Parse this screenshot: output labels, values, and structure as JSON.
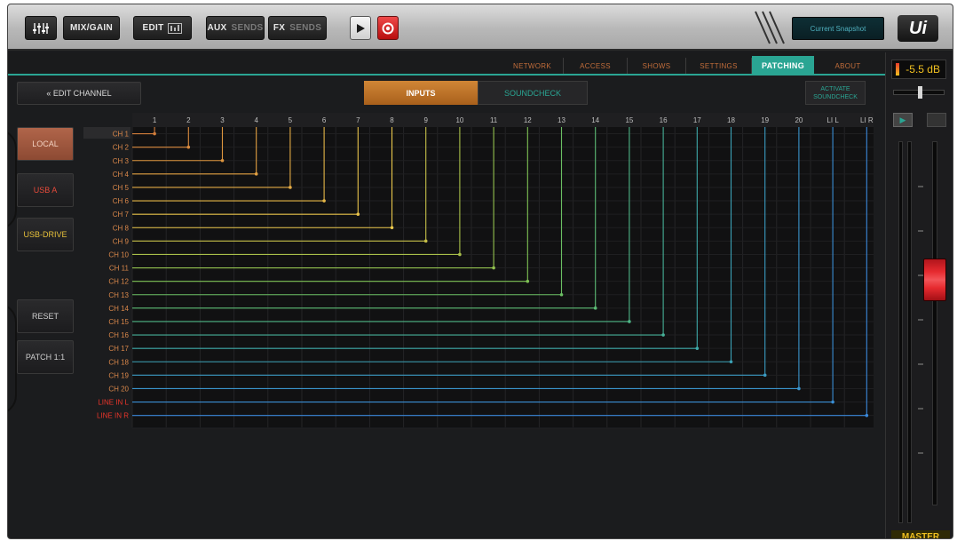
{
  "toolbar": {
    "mixgain_label": "MIX/GAIN",
    "edit_label": "EDIT",
    "aux_label": "AUX",
    "aux_sub": "SENDS",
    "fx_label": "FX",
    "fx_sub": "SENDS",
    "display_text": "Current Snapshot",
    "logo": "Ui"
  },
  "nav": {
    "tabs": [
      "NETWORK",
      "ACCESS",
      "SHOWS",
      "SETTINGS",
      "PATCHING",
      "ABOUT"
    ],
    "active": "PATCHING"
  },
  "body": {
    "edit_channel": "« EDIT CHANNEL",
    "inputs_label": "INPUTS",
    "soundcheck_label": "SOUNDCHECK",
    "activate_label": "ACTIVATE SOUNDCHECK",
    "sources": [
      "LOCAL",
      "USB A",
      "USB-DRIVE"
    ],
    "reset_label": "RESET",
    "patch_label": "PATCH 1:1"
  },
  "matrix": {
    "columns": [
      "1",
      "2",
      "3",
      "4",
      "5",
      "6",
      "7",
      "8",
      "9",
      "10",
      "11",
      "12",
      "13",
      "14",
      "15",
      "16",
      "17",
      "18",
      "19",
      "20",
      "LI L",
      "LI R"
    ],
    "rows": [
      "CH 1",
      "CH 2",
      "CH 3",
      "CH 4",
      "CH 5",
      "CH 6",
      "CH 7",
      "CH 8",
      "CH 9",
      "CH 10",
      "CH 11",
      "CH 12",
      "CH 13",
      "CH 14",
      "CH 15",
      "CH 16",
      "CH 17",
      "CH 18",
      "CH 19",
      "CH 20",
      "LINE IN L",
      "LINE IN R"
    ],
    "line_colors": [
      "#d27d3b",
      "#d98a3e",
      "#de963f",
      "#e2a042",
      "#e4ab45",
      "#e6b747",
      "#e8c24a",
      "#ecc94c",
      "#c6bf48",
      "#a9c04a",
      "#93c24f",
      "#7fc255",
      "#6bbf63",
      "#5cbb74",
      "#4fb687",
      "#46b198",
      "#3ea9a8",
      "#3ba2b6",
      "#3b9bc2",
      "#3a94cc",
      "#3a8ed4",
      "#3a88da"
    ]
  },
  "master": {
    "level": "-5.5 dB",
    "label": "MASTER"
  },
  "colors": {
    "accent_teal": "#2aa593",
    "active_orange": "#c8772a",
    "fader_red": "#e62a2f"
  }
}
